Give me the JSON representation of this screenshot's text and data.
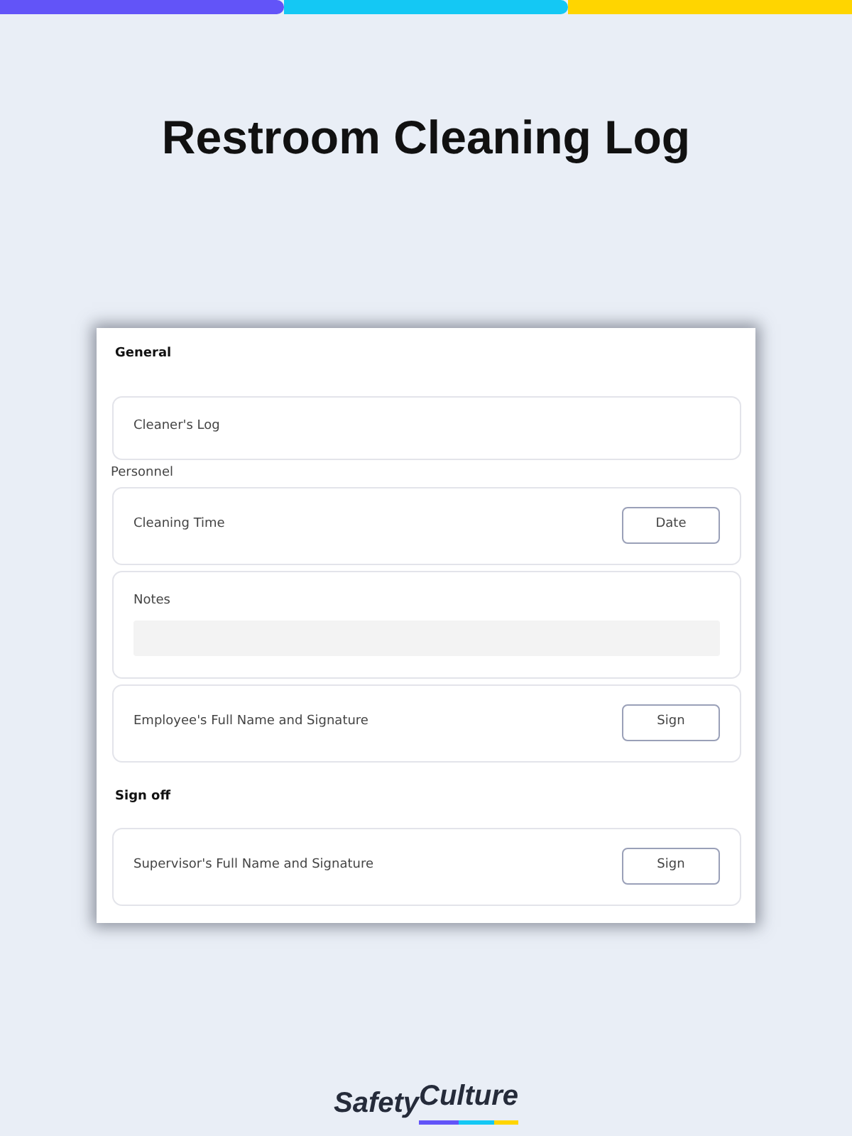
{
  "title": "Restroom Cleaning Log",
  "sections": [
    {
      "title": "General",
      "items": [
        {
          "kind": "label",
          "text": "Cleaner's Log"
        },
        {
          "kind": "heading",
          "text": "Personnel"
        },
        {
          "kind": "button",
          "text": "Cleaning Time",
          "button": "Date"
        },
        {
          "kind": "field",
          "text": "Notes"
        },
        {
          "kind": "button",
          "text": "Employee's Full Name and Signature",
          "button": "Sign"
        }
      ]
    },
    {
      "title": "Sign off",
      "items": [
        {
          "kind": "button",
          "text": "Supervisor's Full Name and Signature",
          "button": "Sign"
        }
      ]
    }
  ],
  "logo": {
    "part_1": "Safety",
    "part_2": "Culture"
  }
}
